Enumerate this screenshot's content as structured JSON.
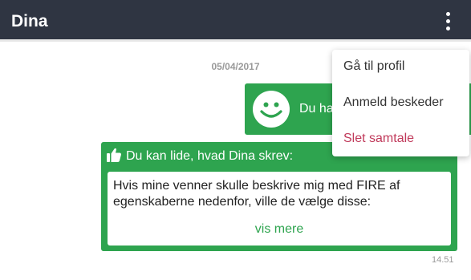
{
  "header": {
    "title": "Dina",
    "menu_icon": "more-vertical-icon"
  },
  "date_separator": "05/04/2017",
  "smile_message": {
    "icon": "smiley-icon",
    "text": "Du ha"
  },
  "like_card": {
    "icon": "thumbs-up-icon",
    "heading": "Du kan lide, hvad Dina skrev:",
    "quote": "Hvis mine venner skulle beskrive mig med FIRE af egenskaberne nedenfor, ville de vælge disse:",
    "more_label": "vis mere"
  },
  "timestamp": "14.51",
  "dropdown": {
    "items": [
      {
        "label": "Gå til profil"
      },
      {
        "label": "Anmeld beskeder"
      },
      {
        "label": "Slet samtale"
      }
    ]
  },
  "colors": {
    "header": "#2f3542",
    "accent_green": "#2ea44f",
    "danger": "#c0395a",
    "muted": "#9a9a9a"
  }
}
